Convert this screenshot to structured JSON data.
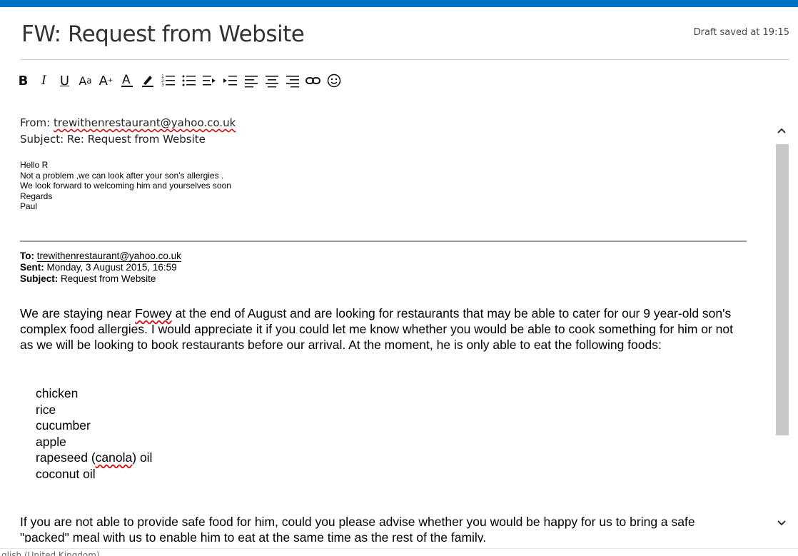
{
  "header": {
    "subject": "FW: Request from Website",
    "draft_status": "Draft saved at 19:15"
  },
  "toolbar": {
    "icons": [
      "bold",
      "italic",
      "underline",
      "font-size",
      "grow-font",
      "font-color",
      "highlight",
      "numbered-list",
      "bullet-list",
      "decrease-indent",
      "increase-indent",
      "align-left",
      "align-center",
      "align-right",
      "insert-link",
      "emoji"
    ]
  },
  "message": {
    "from_label": "From:",
    "from_address": "trewithenrestaurant@yahoo.co.uk",
    "subject_label": "Subject:",
    "subject_value": "Re: Request from Website",
    "reply_lines": [
      "Hello R",
      "Not a problem ,we can look after your son’s allergies .",
      "We look forward to welcoming him and yourselves soon",
      "Regards",
      "Paul"
    ],
    "original": {
      "to_label": "To:",
      "to_address": "trewithenrestaurant@yahoo.co.uk",
      "sent_label": "Sent:",
      "sent_value": "Monday, 3 August 2015, 16:59",
      "subject_label": "Subject:",
      "subject_value": "Request from Website",
      "para1_a": "We are staying near ",
      "para1_fowey": "Fowey",
      "para1_b": " at the end of August and are looking for restaurants that may be able to cater for our 9 year-old son's complex food allergies.  I would appreciate it if you could let me know whether you would be able to cook something for him or not as we will be looking to book restaurants before our arrival.  At the moment, he is only able to eat the following foods:",
      "foods": [
        "chicken",
        "rice",
        "cucumber",
        "apple",
        "rapeseed (canola) oil",
        "coconut oil"
      ],
      "food_rapeseed_a": "rapeseed (",
      "food_canola": "canola",
      "food_rapeseed_b": ") oil",
      "closing": "If you are not able to provide safe food for him, could you please advise whether you would be happy for us to bring a safe \"packed\" meal with us to enable him to eat at the same time as the rest of the family."
    }
  },
  "statusbar": {
    "language": "glish (United Kingdom)"
  },
  "colors": {
    "accent": "#0072c6",
    "spelling": "#dd0000"
  }
}
